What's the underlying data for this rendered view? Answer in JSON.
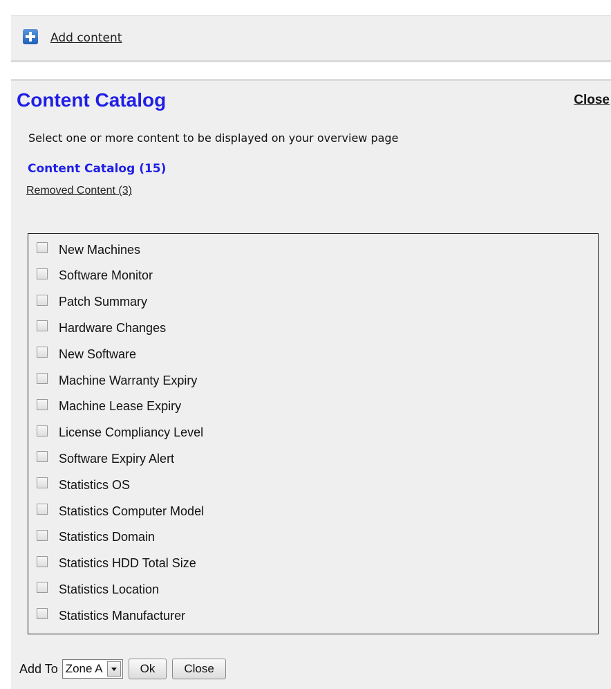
{
  "topbar": {
    "add_content_label": "Add content"
  },
  "panel": {
    "title": "Content Catalog",
    "close_label": "Close",
    "instructions": "Select one or more content to be displayed on your overview page",
    "catalog_heading": "Content Catalog (15)",
    "removed_link": "Removed Content (3)"
  },
  "content_items": [
    {
      "label": "New Machines",
      "checked": false
    },
    {
      "label": "Software Monitor",
      "checked": false
    },
    {
      "label": "Patch Summary",
      "checked": false
    },
    {
      "label": "Hardware Changes",
      "checked": false
    },
    {
      "label": "New Software",
      "checked": false
    },
    {
      "label": "Machine Warranty Expiry",
      "checked": false
    },
    {
      "label": "Machine Lease Expiry",
      "checked": false
    },
    {
      "label": "License Compliancy Level",
      "checked": false
    },
    {
      "label": "Software Expiry Alert",
      "checked": false
    },
    {
      "label": "Statistics OS",
      "checked": false
    },
    {
      "label": "Statistics Computer Model",
      "checked": false
    },
    {
      "label": "Statistics Domain",
      "checked": false
    },
    {
      "label": "Statistics HDD Total Size",
      "checked": false
    },
    {
      "label": "Statistics Location",
      "checked": false
    },
    {
      "label": "Statistics Manufacturer",
      "checked": false
    }
  ],
  "footer": {
    "add_to_label": "Add To",
    "zone_selected": "Zone A",
    "ok_label": "Ok",
    "close_label": "Close"
  },
  "colors": {
    "accent": "#1f1fe6",
    "panel_bg": "#efefef",
    "icon_blue": "#2d6fc8"
  },
  "icons": {
    "add": "plus-icon",
    "dropdown": "chevron-down-icon"
  }
}
